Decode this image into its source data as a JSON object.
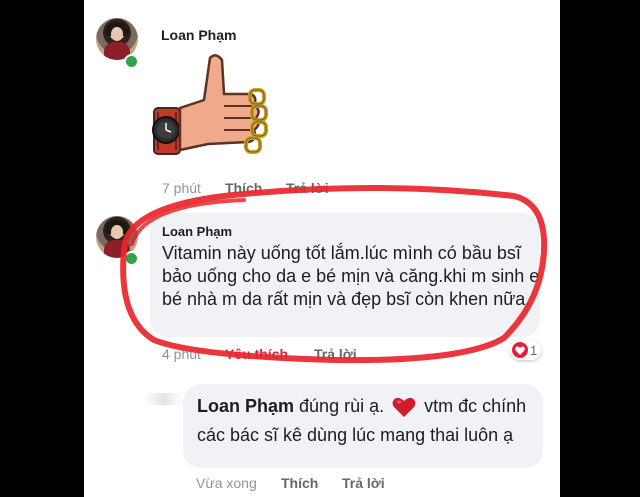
{
  "colors": {
    "accent_red": "#e41e3f",
    "online_green": "#31a24c",
    "bubble_bg": "#f0f2f5"
  },
  "comments": [
    {
      "author": "Loan Phạm",
      "attachment": "thumbs-up-sticker",
      "time": "7 phút",
      "like": "Thích",
      "reply": "Trả lời"
    },
    {
      "author": "Loan Phạm",
      "text": "Vitamin này uống tốt lắm.lúc mình có bầu bsĩ bảo uống cho da e bé mịn và căng.khi m sinh e bé nhà m da rất mịn và đẹp bsĩ còn khen nữa.",
      "time": "4 phút",
      "like": "Yêu thích",
      "reply": "Trả lời",
      "reaction": "heart",
      "reaction_count": "1"
    }
  ],
  "reply": {
    "author": "Loan Phạm",
    "text_before": "đúng rùi ạ.",
    "text_after": "vtm đc chính các bác sĩ kê dùng lúc mang thai luôn ạ",
    "emoji": "heart",
    "time": "Vừa xong",
    "like": "Thích",
    "reply": "Trả lời"
  }
}
